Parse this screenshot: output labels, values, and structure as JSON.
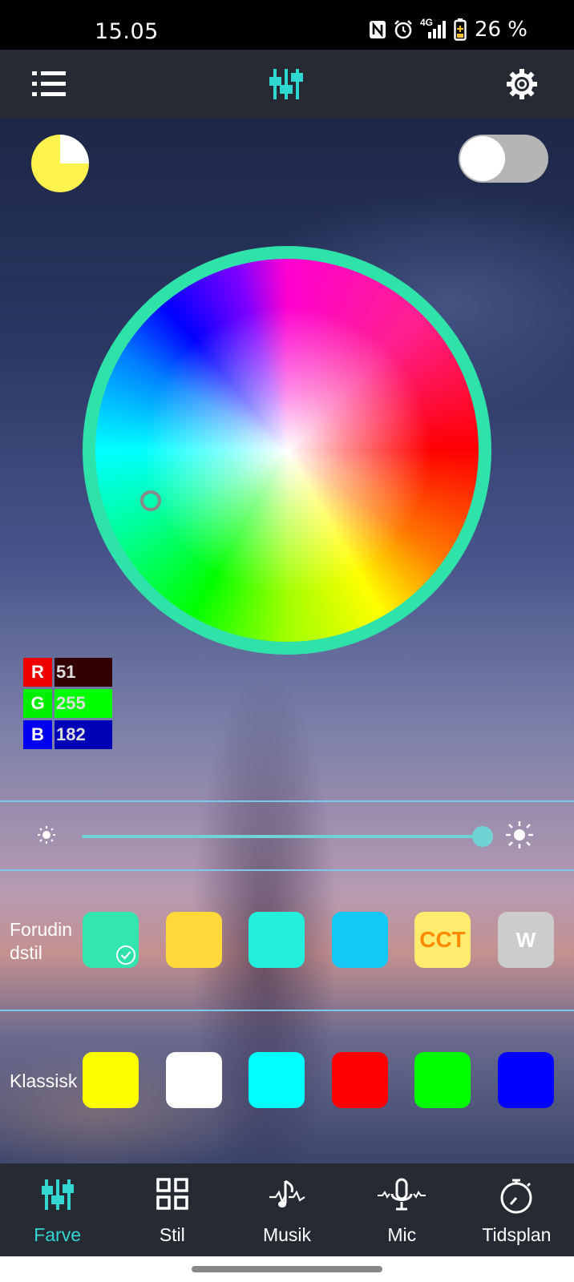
{
  "status_bar": {
    "time": "15.05",
    "network": "4G",
    "battery": "26 %"
  },
  "app_bar": {
    "menu_icon": "menu-list-icon",
    "center_icon": "equalizer-icon",
    "settings_icon": "gear-icon"
  },
  "controls": {
    "mode_icon": "sun-mode-icon",
    "power_on": false
  },
  "color_wheel": {
    "selected_hex": "#33ffb6"
  },
  "rgb": [
    {
      "key": "R",
      "value": "51",
      "key_color": "#ee0000",
      "value_color": "#330000"
    },
    {
      "key": "G",
      "value": "255",
      "key_color": "#00ee00",
      "value_color": "#00ff00"
    },
    {
      "key": "B",
      "value": "182",
      "key_color": "#0000ee",
      "value_color": "#0000b6"
    }
  ],
  "brightness": {
    "level": 1.0
  },
  "presets": {
    "label": "Forudindstil",
    "label_line1": "Forudin",
    "label_line2": "dstil",
    "items": [
      {
        "label": "",
        "color": "#33e6b0",
        "selected": true
      },
      {
        "label": "",
        "color": "#ffd83a",
        "selected": false
      },
      {
        "label": "",
        "color": "#22f0dc",
        "selected": false
      },
      {
        "label": "",
        "color": "#14c8f5",
        "selected": false
      },
      {
        "label": "CCT",
        "color": "#ffec6e",
        "text_color": "#ff8a00",
        "selected": false
      },
      {
        "label": "W",
        "color": "#cccccc",
        "text_color": "#ffffff",
        "selected": false
      }
    ]
  },
  "classic": {
    "label": "Klassisk",
    "items": [
      {
        "color": "#ffff00"
      },
      {
        "color": "#ffffff"
      },
      {
        "color": "#00ffff"
      },
      {
        "color": "#ff0000"
      },
      {
        "color": "#00ff00"
      },
      {
        "color": "#0000ff"
      }
    ]
  },
  "tabs": [
    {
      "label": "Farve",
      "icon": "equalizer-icon",
      "active": true
    },
    {
      "label": "Stil",
      "icon": "grid-icon",
      "active": false
    },
    {
      "label": "Musik",
      "icon": "music-icon",
      "active": false
    },
    {
      "label": "Mic",
      "icon": "microphone-icon",
      "active": false
    },
    {
      "label": "Tidsplan",
      "icon": "stopwatch-icon",
      "active": false
    }
  ],
  "accent_color": "#34d6d2"
}
